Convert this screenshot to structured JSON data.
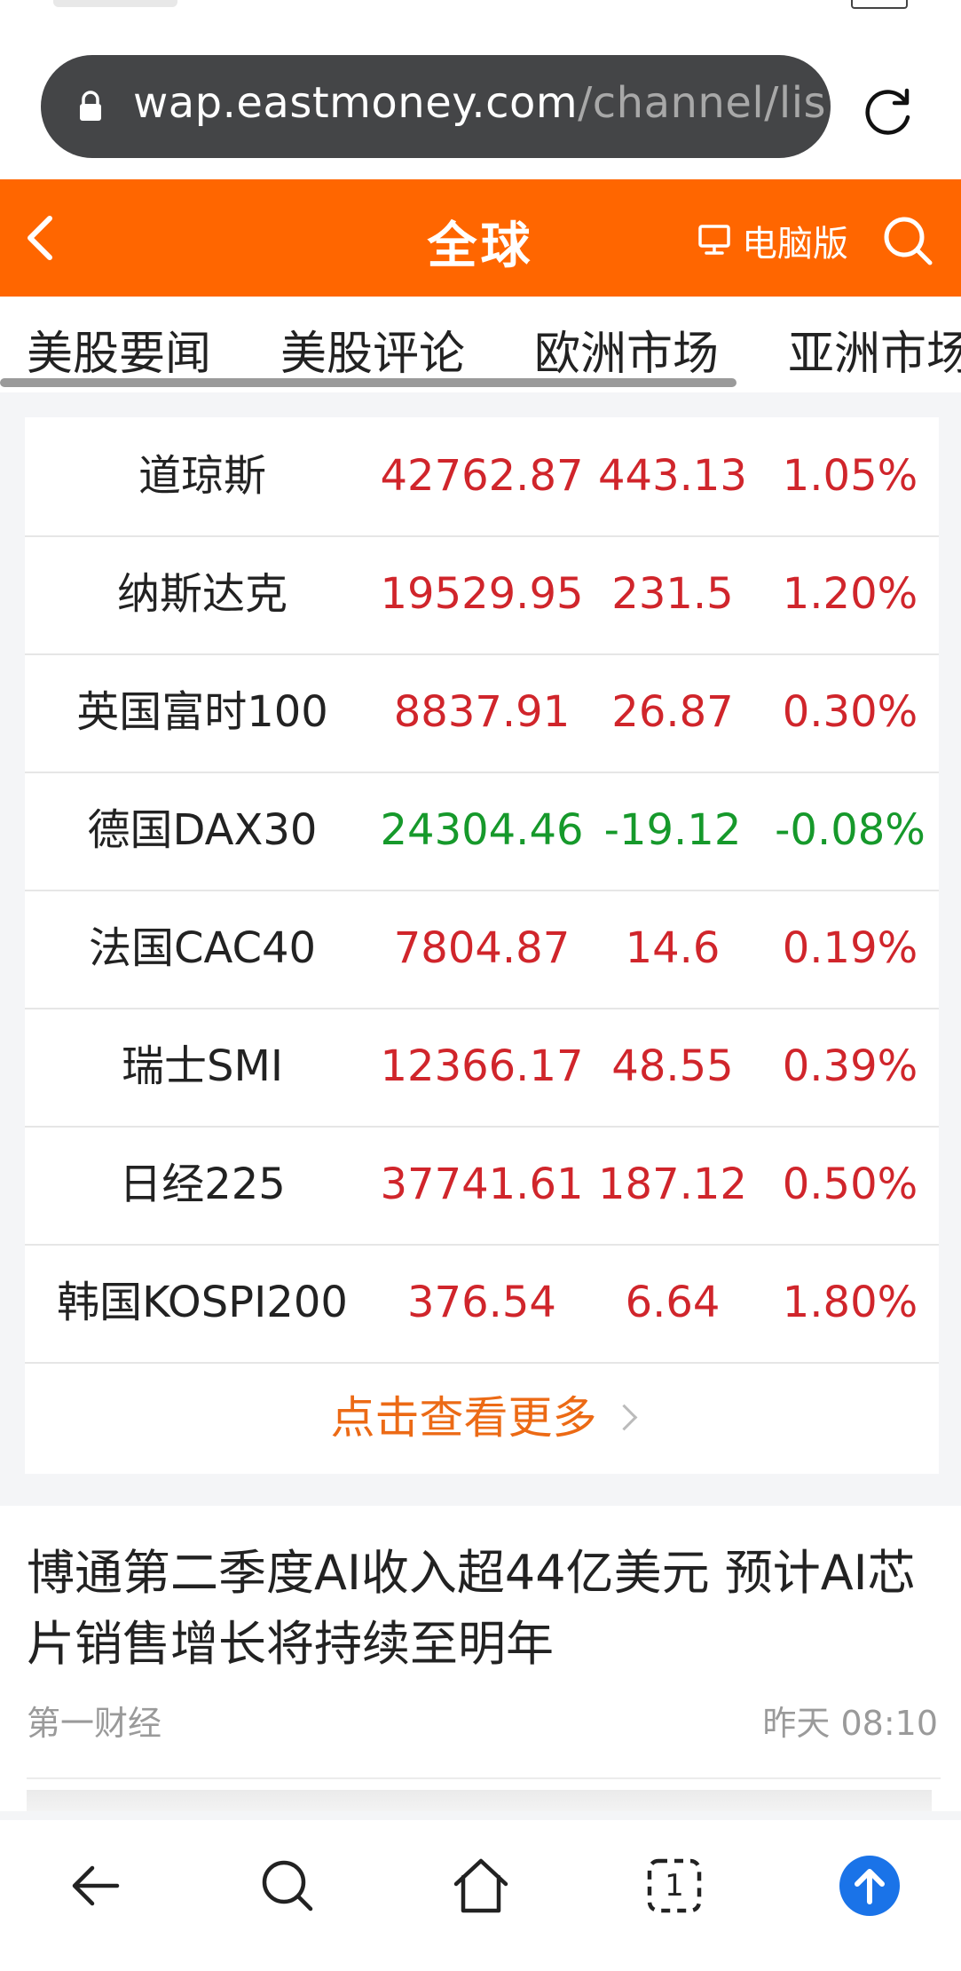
{
  "browser": {
    "url_host": "wap.eastmoney.com",
    "url_path": "/channel/lis"
  },
  "header": {
    "title": "全球",
    "pc_label": "电脑版"
  },
  "tabs": [
    {
      "label": "美股要闻"
    },
    {
      "label": "美股评论"
    },
    {
      "label": "欧洲市场"
    },
    {
      "label": "亚洲市场"
    }
  ],
  "quotes": [
    {
      "name": "道琼斯",
      "price": "42762.87",
      "change": "443.13",
      "pct": "1.05%",
      "dir": "up"
    },
    {
      "name": "纳斯达克",
      "price": "19529.95",
      "change": "231.5",
      "pct": "1.20%",
      "dir": "up"
    },
    {
      "name": "英国富时100",
      "price": "8837.91",
      "change": "26.87",
      "pct": "0.30%",
      "dir": "up"
    },
    {
      "name": "德国DAX30",
      "price": "24304.46",
      "change": "-19.12",
      "pct": "-0.08%",
      "dir": "down"
    },
    {
      "name": "法国CAC40",
      "price": "7804.87",
      "change": "14.6",
      "pct": "0.19%",
      "dir": "up"
    },
    {
      "name": "瑞士SMI",
      "price": "12366.17",
      "change": "48.55",
      "pct": "0.39%",
      "dir": "up"
    },
    {
      "name": "日经225",
      "price": "37741.61",
      "change": "187.12",
      "pct": "0.50%",
      "dir": "up"
    },
    {
      "name": "韩国KOSPI200",
      "price": "376.54",
      "change": "6.64",
      "pct": "1.80%",
      "dir": "up"
    }
  ],
  "more_label": "点击查看更多",
  "news": {
    "title": "博通第二季度AI收入超44亿美元 预计AI芯片销售增长将持续至明年",
    "source": "第一财经",
    "time": "昨天 08:10"
  },
  "colors": {
    "brand": "#ff6600",
    "up": "#d0252b",
    "down": "#16992b",
    "more": "#ec6a15",
    "nav_accent": "#1a73e8"
  },
  "icons": {
    "lock": "lock-icon",
    "reload": "reload-icon",
    "back": "chevron-left-icon",
    "pc": "monitor-icon",
    "search": "search-icon",
    "nav": [
      "back-arrow-icon",
      "search-icon",
      "home-icon",
      "tabs-icon",
      "scroll-top-icon"
    ]
  },
  "bottom_nav": {
    "tab_count": "1"
  }
}
